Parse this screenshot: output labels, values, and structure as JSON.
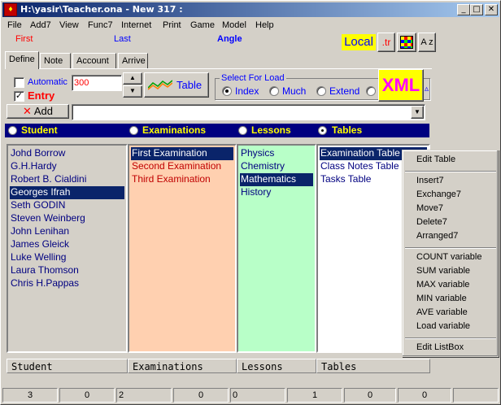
{
  "window": {
    "title": "H:\\yasir\\Teacher.ona - New 317 :",
    "icon": "app-icon"
  },
  "menu": [
    "File",
    "Add7",
    "View",
    "Func7",
    "Internet",
    "Print",
    "Game",
    "Model",
    "Help"
  ],
  "header": {
    "first": "First",
    "last": "Last",
    "angle": "Angle",
    "local": "Local",
    "tr": ".tr",
    "az": "A z"
  },
  "tabs": [
    "Define",
    "Note",
    "Account",
    "Arrive"
  ],
  "controls": {
    "automatic": "Automatic",
    "number_value": "300",
    "entry": "Entry",
    "table_button": "Table",
    "add_button": "Add",
    "combo_value": ""
  },
  "load_group": {
    "title": "Select For Load",
    "options": [
      "Index",
      "Much",
      "Extend"
    ],
    "selected": "Index"
  },
  "xml_label": "XML",
  "sections": [
    "Student",
    "Examinations",
    "Lessons",
    "Tables"
  ],
  "selected_section": "Tables",
  "lists": {
    "students": [
      "Johd Borrow",
      "G.H.Hardy",
      "Robert B. Cialdini",
      "Georges Ifrah",
      "Seth GODIN",
      "Steven Weinberg",
      "John Lenihan",
      "James Gleick",
      "Luke Welling",
      "Laura Thomson",
      "Chris H.Pappas"
    ],
    "students_selected": 3,
    "examinations": [
      "First Examination",
      "Second Examination",
      "Third Examination"
    ],
    "examinations_selected": 0,
    "lessons": [
      "Physics",
      "Chemistry",
      "Mathematics",
      "History"
    ],
    "lessons_selected": 2,
    "tables": [
      "Examination Table",
      "Class Notes Table",
      "Tasks Table"
    ],
    "tables_selected": 0
  },
  "column_headers": [
    "Student",
    "Examinations",
    "Lessons",
    "Tables"
  ],
  "status": [
    "3",
    "0",
    "2",
    "0",
    "0",
    "1",
    "0",
    "0"
  ],
  "context_menu": {
    "items": [
      [
        "Edit Table"
      ],
      [
        "Insert7",
        "Exchange7",
        "Move7",
        "Delete7",
        "Arranged7"
      ],
      [
        "COUNT variable",
        "SUM variable",
        "MAX variable",
        "MIN variable",
        "AVE variable",
        "Load variable"
      ],
      [
        "Edit ListBox"
      ]
    ]
  },
  "colors": {
    "student_bg": "#d4d0c8",
    "exam_bg": "#ffd0b0",
    "lesson_bg": "#b8ffc8",
    "table_bg": "#ffffff",
    "bar": "#000080",
    "accent_red": "#ff0000",
    "accent_blue": "#0000ff"
  }
}
